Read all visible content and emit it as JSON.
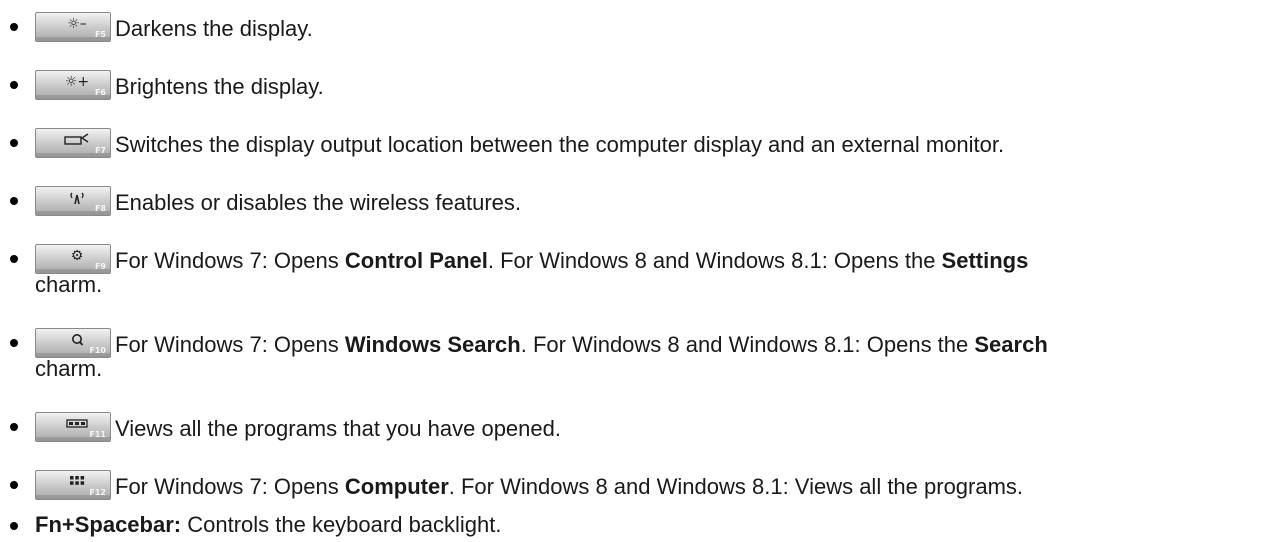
{
  "items": [
    {
      "key_fn": "F5",
      "key_icon": "brightness-down-icon",
      "text": "Darkens the display."
    },
    {
      "key_fn": "F6",
      "key_icon": "brightness-up-icon",
      "text": "Brightens the display."
    },
    {
      "key_fn": "F7",
      "key_icon": "display-switch-icon",
      "text": "Switches the display output location between the computer display and an external monitor."
    },
    {
      "key_fn": "F8",
      "key_icon": "wireless-icon",
      "text": "Enables or disables the wireless features."
    },
    {
      "key_fn": "F9",
      "key_icon": "settings-gear-icon",
      "t1": "For Windows 7: Opens ",
      "b1": "Control Panel",
      "t2": ". For Windows 8 and Windows 8.1: Opens the ",
      "b2": "Settings",
      "cont": "charm."
    },
    {
      "key_fn": "F10",
      "key_icon": "search-icon",
      "t1": "For Windows 7: Opens ",
      "b1": "Windows Search",
      "t2": ". For Windows 8 and Windows 8.1: Opens the ",
      "b2": "Search",
      "cont": "charm."
    },
    {
      "key_fn": "F11",
      "key_icon": "open-programs-icon",
      "text": "Views all the programs that you have opened."
    },
    {
      "key_fn": "F12",
      "key_icon": "all-programs-grid-icon",
      "t1": "For Windows 7: Opens ",
      "b1": "Computer",
      "t2": ". For Windows 8 and Windows 8.1: Views all the programs."
    },
    {
      "b1": "Fn+Spacebar:",
      "t1": " Controls the keyboard backlight."
    }
  ],
  "colors": {
    "text": "#1a1a1a",
    "key_gradient_top": "#f2f2f2",
    "key_gradient_bottom": "#a9a9a9"
  }
}
